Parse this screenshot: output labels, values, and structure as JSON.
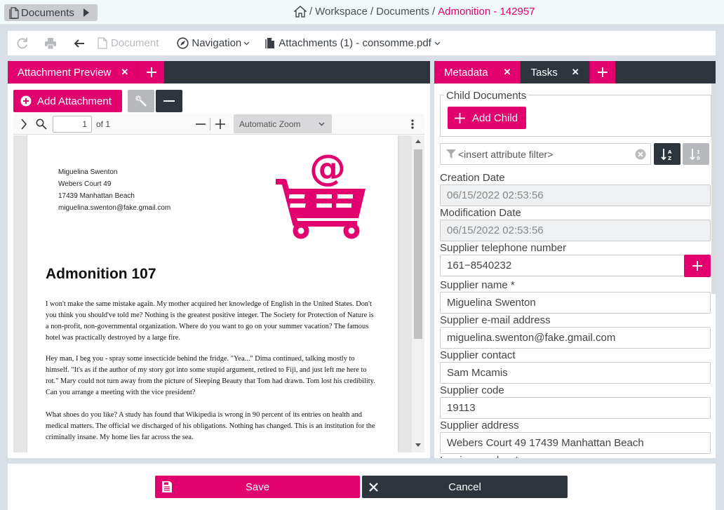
{
  "topbar": {
    "documents_label": "Documents",
    "breadcrumb": {
      "home_icon": "home-icon",
      "items": [
        "Workspace",
        "Documents"
      ],
      "current": "Admonition - 142957",
      "separator": "/"
    }
  },
  "toolbar": {
    "refresh_icon": "refresh-icon",
    "print_icon": "print-icon",
    "back_icon": "arrow-left-icon",
    "document_label": "Document",
    "navigation_label": "Navigation",
    "attachments_label": "Attachments (1) - consomme.pdf"
  },
  "left_panel": {
    "tabs": [
      {
        "label": "Attachment Preview",
        "active": true
      }
    ],
    "add_attachment_label": "Add Attachment",
    "pdf_toolbar": {
      "page_value": "1",
      "page_total": "of 1",
      "zoom_selected": "Automatic Zoom"
    },
    "pdf": {
      "address_lines": [
        "Miguelina Swenton",
        "Webers Court 49",
        "17439 Manhattan Beach",
        "miguelina.swenton@fake.gmail.com"
      ],
      "title": "Admonition 107",
      "paragraphs": [
        "I won't make the same mistake again. My mother acquired her knowledge of English in the United States. Don't you think you should've told me? Nothing is the greatest positive integer. The Society for Protection of Nature is a non-profit, non-governmental organization. Where do you want to go on your summer vacation? The famous hotel was practically destroyed by a large fire.",
        "Hey man, I beg you - spray some insecticide behind the fridge. \"Yea...\" Dima continued, talking mostly to himself. \"It's as if the author of my story got into some stupid argument, retired to Fiji, and just left me here to rot.\" Mary could not turn away from the picture of Sleeping Beauty that Tom had drawn. Tom lost his credibility. Can you arrange a meeting with the vice president?",
        "What shoes do you like? A study has found that Wikipedia is wrong in 90 percent of its entries on health and medical matters. The official we discharged of his obligations. Nothing has changed. This is an institution for the criminally insane. My home lies far across the sea."
      ]
    }
  },
  "right_panel": {
    "tabs": [
      {
        "label": "Metadata",
        "active": true
      },
      {
        "label": "Tasks",
        "active": false
      }
    ],
    "child_documents_label": "Child Documents",
    "add_child_label": "Add Child",
    "filter_placeholder": "<insert attribute filter>",
    "fields": [
      {
        "label": "Creation Date",
        "value": "06/15/2022 02:53:56",
        "readonly": true
      },
      {
        "label": "Modification Date",
        "value": "06/15/2022 02:53:56",
        "readonly": true
      },
      {
        "label": "Supplier telephone number",
        "value": "161−8540232"
      },
      {
        "label": "Supplier name *",
        "value": "Miguelina Swenton"
      },
      {
        "label": "Supplier e-mail address",
        "value": "miguelina.swenton@fake.gmail.com"
      },
      {
        "label": "Supplier contact",
        "value": "Sam Mcamis"
      },
      {
        "label": "Supplier code",
        "value": "19113"
      },
      {
        "label": "Supplier address",
        "value": "Webers Court 49 17439 Manhattan Beach"
      },
      {
        "label": "Invoice number *",
        "value": ""
      }
    ]
  },
  "footer": {
    "save_label": "Save",
    "cancel_label": "Cancel"
  },
  "colors": {
    "accent": "#e2006f",
    "dark": "#2d343c",
    "disabled": "#b6b8bc"
  }
}
